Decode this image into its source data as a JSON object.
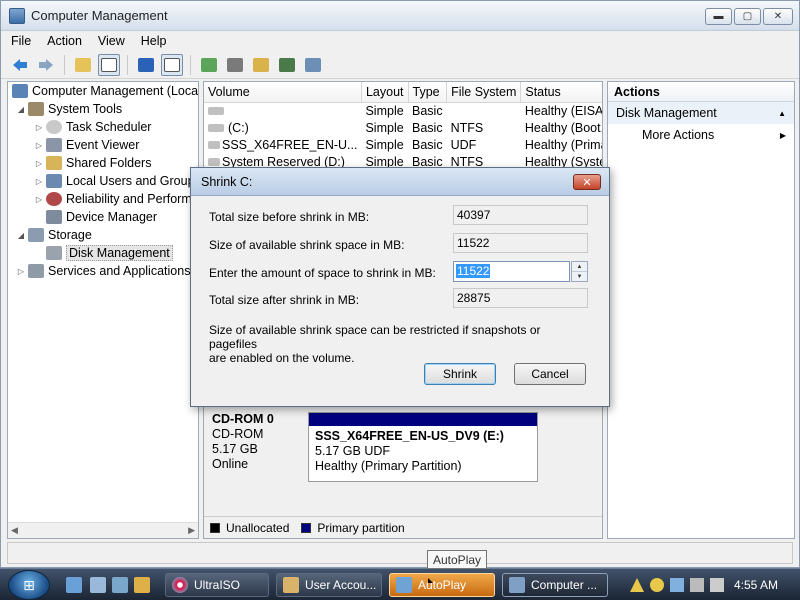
{
  "window": {
    "title": "Computer Management",
    "controls": {
      "minimize": "▬",
      "maximize": "▢",
      "close": "✕"
    }
  },
  "menu": [
    "File",
    "Action",
    "View",
    "Help"
  ],
  "toolbar_icons": [
    "back-arrow-icon",
    "forward-arrow-icon",
    "up-folder-icon",
    "show-hide-tree-icon",
    "help-icon",
    "show-hide-action-pane-icon",
    "refresh-icon",
    "properties-icon",
    "open-folder-icon",
    "search-icon",
    "export-list-icon"
  ],
  "tree": {
    "items": [
      {
        "label": "Computer Management (Local",
        "icon": "computer-management-icon",
        "toggle": ""
      },
      {
        "label": "System Tools",
        "icon": "system-tools-icon",
        "toggle": "◢"
      },
      {
        "label": "Task Scheduler",
        "icon": "clock-icon",
        "toggle": "▷"
      },
      {
        "label": "Event Viewer",
        "icon": "event-viewer-icon",
        "toggle": "▷"
      },
      {
        "label": "Shared Folders",
        "icon": "shared-folder-icon",
        "toggle": "▷"
      },
      {
        "label": "Local Users and Group",
        "icon": "users-icon",
        "toggle": "▷"
      },
      {
        "label": "Reliability and Perform",
        "icon": "performance-icon",
        "toggle": "▷"
      },
      {
        "label": "Device Manager",
        "icon": "device-manager-icon",
        "toggle": ""
      },
      {
        "label": "Storage",
        "icon": "storage-icon",
        "toggle": "◢"
      },
      {
        "label": "Disk Management",
        "icon": "disk-icon",
        "toggle": ""
      },
      {
        "label": "Services and Applications",
        "icon": "services-icon",
        "toggle": "▷"
      }
    ],
    "scroll_left": "◀",
    "scroll_right": "▶"
  },
  "volumes": {
    "headers": [
      "Volume",
      "Layout",
      "Type",
      "File System",
      "Status"
    ],
    "rows": [
      [
        "",
        "Simple",
        "Basic",
        "",
        "Healthy (EISA Con"
      ],
      [
        "(C:)",
        "Simple",
        "Basic",
        "NTFS",
        "Healthy (Boot, Pag"
      ],
      [
        "SSS_X64FREE_EN-U...",
        "Simple",
        "Basic",
        "UDF",
        "Healthy (Primary P"
      ],
      [
        "System Reserved (D:)",
        "Simple",
        "Basic",
        "NTFS",
        "Healthy (System, A"
      ]
    ]
  },
  "disk": {
    "name": "CD-ROM 0",
    "type": "CD-ROM",
    "size": "5.17 GB",
    "state": "Online",
    "partition": {
      "label": "SSS_X64FREE_EN-US_DV9  (E:)",
      "detail": "5.17 GB UDF",
      "status": "Healthy (Primary Partition)"
    }
  },
  "legend": {
    "unallocated": "Unallocated",
    "primary": "Primary partition",
    "colors": {
      "unallocated": "#000000",
      "primary": "#00007f"
    }
  },
  "actions": {
    "header": "Actions",
    "section": "Disk Management",
    "section_arrow": "▲",
    "more": "More Actions",
    "more_arrow": "▶"
  },
  "dialog": {
    "title": "Shrink C:",
    "close": "✕",
    "total_before_label": "Total size before shrink in MB:",
    "total_before_value": "40397",
    "available_label": "Size of available shrink space in MB:",
    "available_value": "11522",
    "amount_label": "Enter the amount of space to shrink in MB:",
    "amount_value": "11522",
    "total_after_label": "Total size after shrink in MB:",
    "total_after_value": "28875",
    "note_line1": "Size of available shrink space can be restricted if snapshots or pagefiles",
    "note_line2": "are enabled on the volume.",
    "shrink_button": "Shrink",
    "cancel_button": "Cancel",
    "spin_up": "▲",
    "spin_down": "▼"
  },
  "taskbar": {
    "start_glyph": "⊞",
    "tasks": [
      {
        "label": "UltraISO",
        "icon": "ultraiso-icon"
      },
      {
        "label": "User Accou...",
        "icon": "user-accounts-icon"
      },
      {
        "label": "AutoPlay",
        "icon": "autoplay-icon"
      },
      {
        "label": "Computer ...",
        "icon": "computer-management-icon"
      }
    ],
    "clock": "4:55 AM",
    "tooltip": "AutoPlay"
  },
  "colors": {
    "accent": "#3399ff",
    "partition_bar": "#00007f",
    "autoplay_flash": "#e08a2a"
  }
}
